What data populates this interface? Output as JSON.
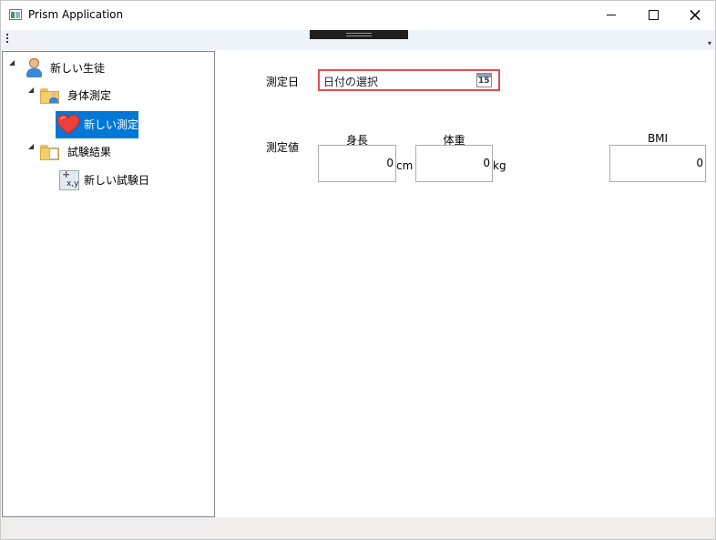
{
  "window": {
    "title": "Prism Application",
    "buttons": {
      "minimize": "minimize",
      "maximize": "maximize",
      "close": "×"
    }
  },
  "toolbar": {
    "overflow_glyph": "▾"
  },
  "tree": {
    "root": {
      "label": "新しい生徒",
      "icon": "student-icon",
      "expander": "◢"
    },
    "groups": [
      {
        "label": "身体測定",
        "icon": "folder-person-icon",
        "expander": "◢",
        "children": [
          {
            "label": "新しい測定",
            "icon": "heart-icon",
            "selected": true
          }
        ]
      },
      {
        "label": "試験結果",
        "icon": "folder-document-icon",
        "expander": "◢",
        "children": [
          {
            "label": "新しい試験日",
            "icon": "xy-chart-icon",
            "icon_text": "x,y",
            "selected": false
          }
        ]
      }
    ]
  },
  "form": {
    "date_label": "測定日",
    "date_placeholder": "日付の選択",
    "calendar_icon_text": "15",
    "values_label": "測定値",
    "height": {
      "header": "身長",
      "value": "0",
      "unit": "cm"
    },
    "weight": {
      "header": "体重",
      "value": "0",
      "unit": "kg"
    },
    "bmi": {
      "header": "BMI",
      "value": "0"
    }
  },
  "colors": {
    "selection": "#0078d7",
    "error_border": "#e04d4d",
    "toolbar_bg": "#eef3fa"
  }
}
